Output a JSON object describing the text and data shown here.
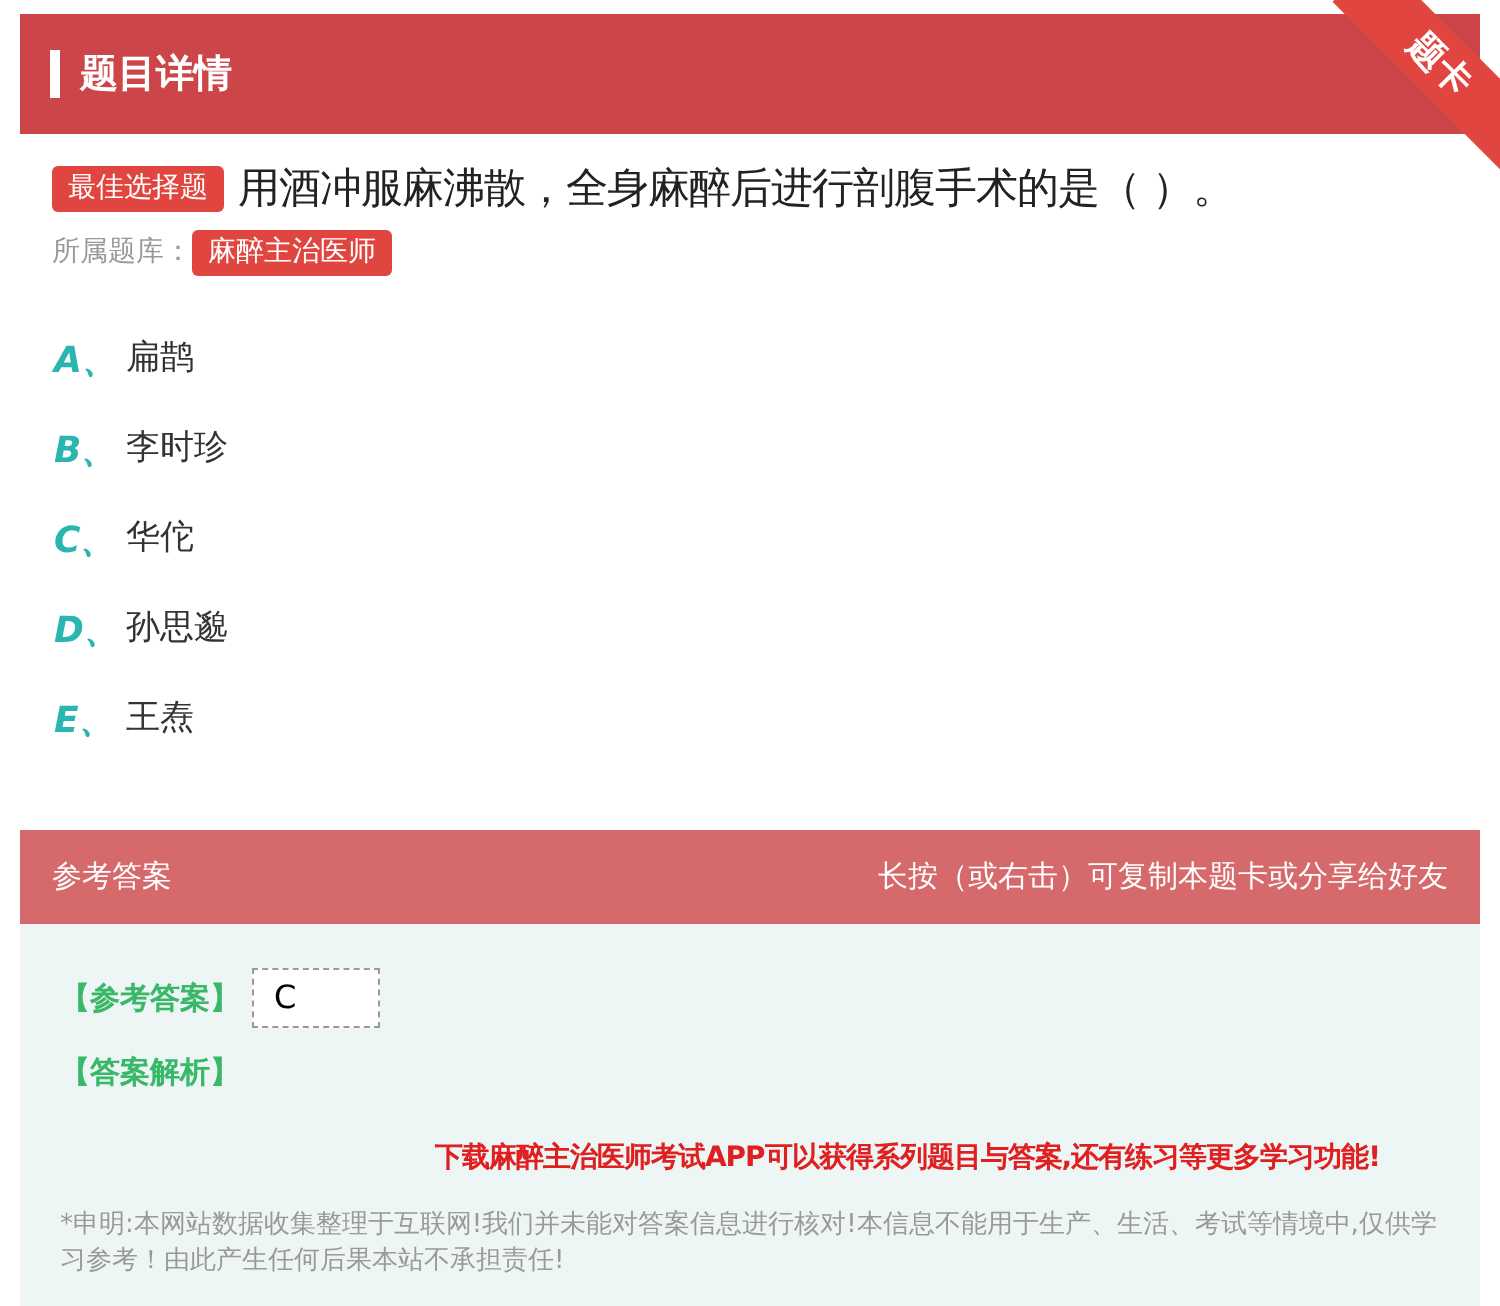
{
  "header": {
    "title": "题目详情",
    "ribbon": "题卡"
  },
  "question": {
    "type_badge": "最佳选择题",
    "text": "用酒冲服麻沸散，全身麻醉后进行剖腹手术的是（ ）。",
    "bank_label": "所属题库：",
    "bank": "麻醉主治医师"
  },
  "options": [
    {
      "letter": "A、",
      "text": "扁鹊"
    },
    {
      "letter": "B、",
      "text": "李时珍"
    },
    {
      "letter": "C、",
      "text": "华佗"
    },
    {
      "letter": "D、",
      "text": "孙思邈"
    },
    {
      "letter": "E、",
      "text": "王焘"
    }
  ],
  "answer_section": {
    "title": "参考答案",
    "hint": "长按（或右击）可复制本题卡或分享给好友",
    "answer_label": "【参考答案】",
    "answer": "C",
    "analysis_label": "【答案解析】",
    "promo": "下载麻醉主治医师考试APP可以获得系列题目与答案,还有练习等更多学习功能!",
    "disclaimer": "*申明:本网站数据收集整理于互联网!我们并未能对答案信息进行核对!本信息不能用于生产、生活、考试等情境中,仅供学习参考！由此产生任何后果本站不承担责任!"
  }
}
